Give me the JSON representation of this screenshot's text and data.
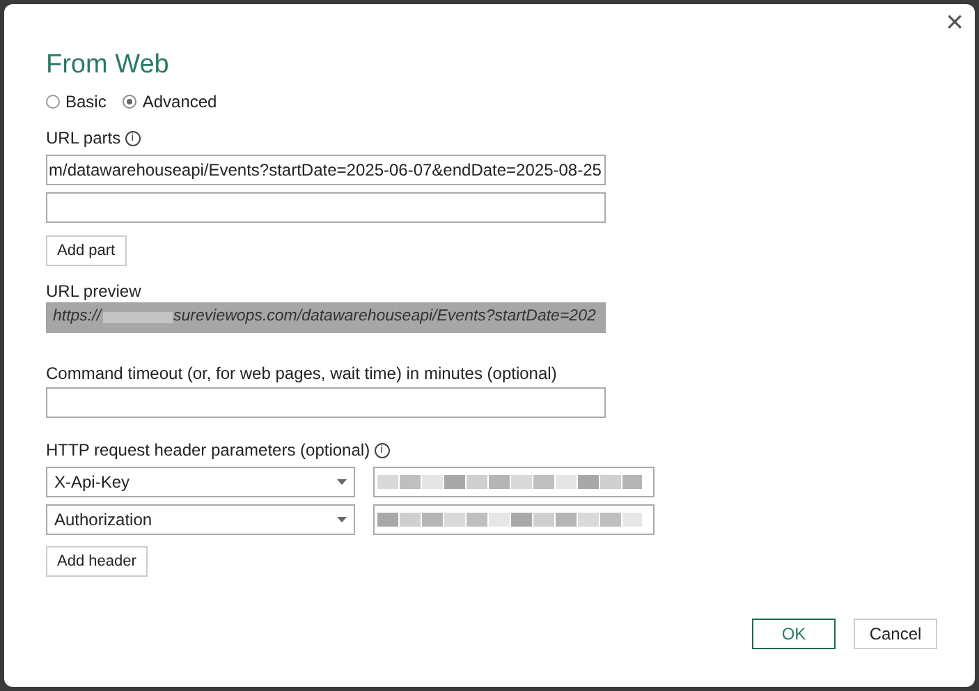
{
  "dialog": {
    "title": "From Web",
    "close": "×"
  },
  "modes": [
    {
      "label": "Basic",
      "selected": false
    },
    {
      "label": "Advanced",
      "selected": true
    }
  ],
  "url_parts": {
    "label": "URL parts",
    "info": "i",
    "parts": [
      {
        "value": "m/datawarehouseapi/Events?startDate=2025-06-07&endDate=2025-08-25"
      }
    ],
    "add_button": "Add part"
  },
  "url_preview": {
    "label": "URL preview",
    "start": "https://",
    "end": "sureviewops.com/datawarehouseapi/Events?startDate=202"
  },
  "timeout": {
    "label": "Command timeout (or, for web pages, wait time) in minutes (optional)"
  },
  "headers": {
    "label": "HTTP request header parameters (optional)",
    "info": "i",
    "rows": [
      {
        "name": "X-Api-Key"
      },
      {
        "name": "Authorization"
      }
    ],
    "add_button": "Add header"
  },
  "buttons": [
    {
      "label": "OK",
      "kind": "primary"
    },
    {
      "label": "Cancel",
      "kind": "secondary"
    }
  ]
}
